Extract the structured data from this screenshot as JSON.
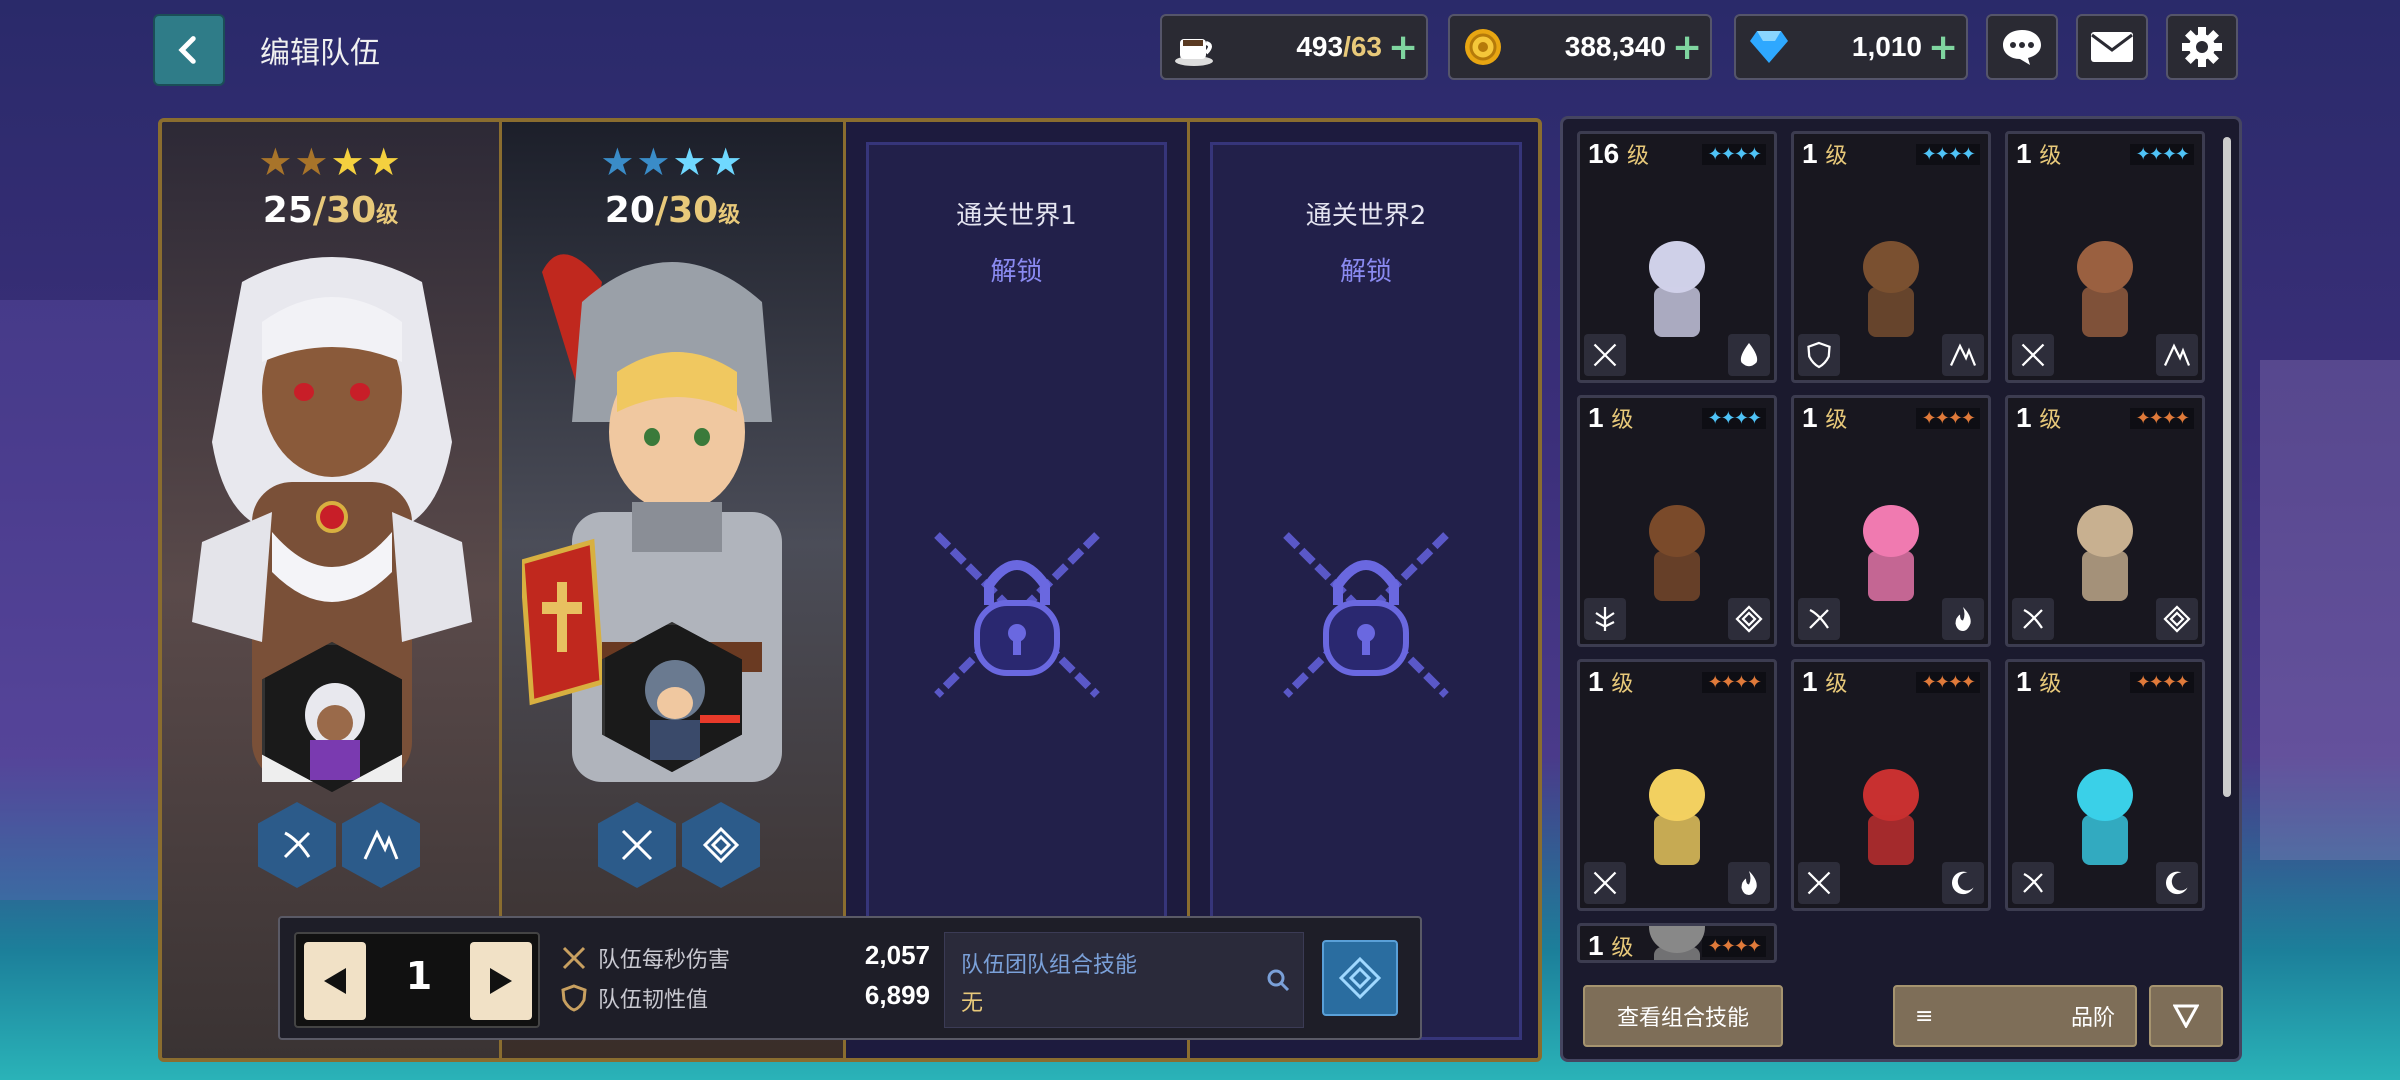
{
  "header": {
    "title": "编辑队伍",
    "stamina": {
      "current": "493",
      "sep": "/",
      "max": "63"
    },
    "gold": "388,340",
    "gems": "1,010"
  },
  "team_slots": [
    {
      "stars_filled": 4,
      "stars_total": 4,
      "level": "25",
      "level_max": "30",
      "level_unit": "级"
    },
    {
      "stars_filled": 4,
      "stars_total": 4,
      "level": "20",
      "level_max": "30",
      "level_unit": "级"
    },
    {
      "locked": true,
      "title": "通关世界1",
      "subtitle": "解锁"
    },
    {
      "locked": true,
      "title": "通关世界2",
      "subtitle": "解锁"
    }
  ],
  "info": {
    "page": "1",
    "dps_label": "队伍每秒伤害",
    "dps_value": "2,057",
    "tough_label": "队伍韧性值",
    "tough_value": "6,899",
    "combo_title": "队伍团队组合技能",
    "combo_value": "无"
  },
  "roster": {
    "cards": [
      {
        "level": "16",
        "unit": "级",
        "stars": "✦✦✦✦",
        "star_color": "#4fc3f7",
        "role": "sword-icon",
        "elem": "water-icon"
      },
      {
        "level": "1",
        "unit": "级",
        "stars": "✦✦✦✦",
        "star_color": "#4fc3f7",
        "role": "shield-icon",
        "elem": "earth-icon"
      },
      {
        "level": "1",
        "unit": "级",
        "stars": "✦✦✦✦",
        "star_color": "#4fc3f7",
        "role": "sword-icon",
        "elem": "earth-icon"
      },
      {
        "level": "1",
        "unit": "级",
        "stars": "✦✦✦✦",
        "star_color": "#4fc3f7",
        "role": "support-icon",
        "elem": "basic-icon"
      },
      {
        "level": "1",
        "unit": "级",
        "stars": "✦✦✦✦",
        "star_color": "#e07a3a",
        "role": "bow-icon",
        "elem": "fire-icon"
      },
      {
        "level": "1",
        "unit": "级",
        "stars": "✦✦✦✦",
        "star_color": "#e07a3a",
        "role": "bow-icon",
        "elem": "basic-icon"
      },
      {
        "level": "1",
        "unit": "级",
        "stars": "✦✦✦✦",
        "star_color": "#e07a3a",
        "role": "sword-icon",
        "elem": "fire-icon"
      },
      {
        "level": "1",
        "unit": "级",
        "stars": "✦✦✦✦",
        "star_color": "#e07a3a",
        "role": "sword-icon",
        "elem": "dark-icon"
      },
      {
        "level": "1",
        "unit": "级",
        "stars": "✦✦✦✦",
        "star_color": "#e07a3a",
        "role": "bow-icon",
        "elem": "dark-icon"
      },
      {
        "level": "1",
        "unit": "级",
        "stars": "✦✦✦✦",
        "star_color": "#e07a3a"
      }
    ],
    "view_combo": "查看组合技能",
    "sort_label": "品阶"
  }
}
